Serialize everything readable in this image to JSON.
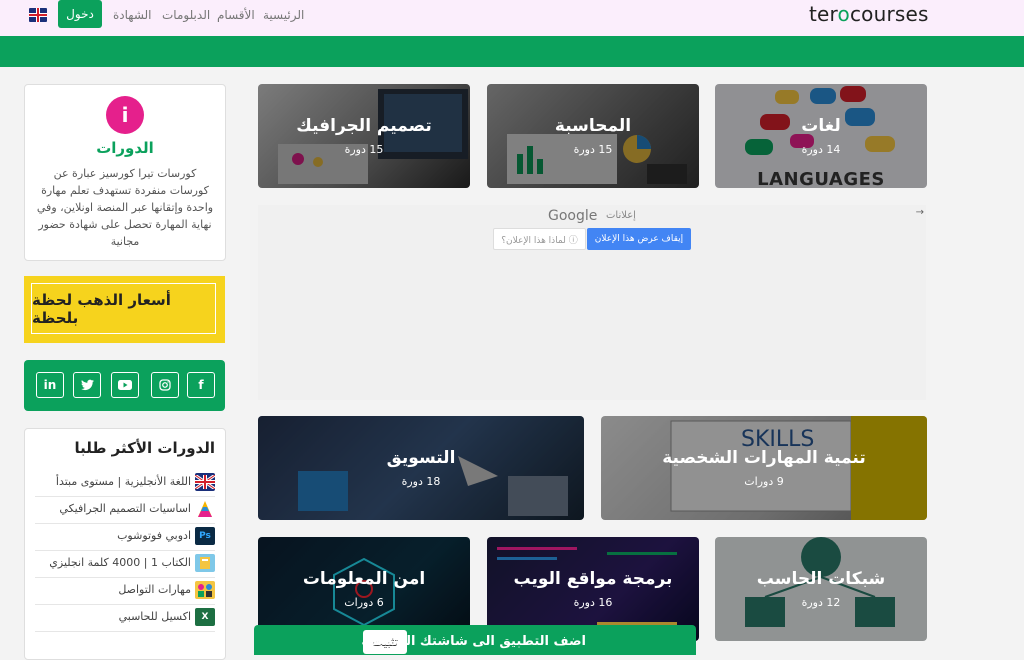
{
  "nav": {
    "logo_part1": "ter",
    "logo_o": "o",
    "logo_part2": "courses",
    "links": [
      "الرئيسية",
      "الأقسام",
      "الدبلومات",
      "الشهادة"
    ],
    "login_label": "دخول",
    "language_icon": "uk-flag-icon"
  },
  "sidebar": {
    "info_title": "الدورات",
    "info_icon": "info-icon",
    "info_text": "كورسات تيرا كورسيز عبارة عن كورسات منفردة تستهدف تعلم مهارة واحدة وإتقانها عبر المنصة اونلاين، وفي نهاية المهارة تحصل على شهادة حضور مجانية",
    "gold_banner": "أسعار الذهب لحظة بلحظة",
    "social": [
      "facebook-icon",
      "instagram-icon",
      "youtube-icon",
      "twitter-icon",
      "linkedin-icon"
    ],
    "popular_title": "الدورات الأكثر طلبا",
    "popular": [
      {
        "label": "اللغة الأنجليزية | مستوى مبتدأ",
        "icon": "uk-flag-icon"
      },
      {
        "label": "اساسيات التصميم الجرافيكي",
        "icon": "design-icon"
      },
      {
        "label": "ادوبي فوتوشوب",
        "icon": "photoshop-icon"
      },
      {
        "label": "الكتاب 1 | 4000 كلمة انجليزي",
        "icon": "book-icon"
      },
      {
        "label": "مهارات التواصل",
        "icon": "communication-icon"
      },
      {
        "label": "اكسيل للحاسبي",
        "icon": "excel-icon"
      }
    ]
  },
  "courses": [
    {
      "title": "لغات",
      "count": "14 دورة",
      "caption": "LANGUAGES"
    },
    {
      "title": "المحاسبة",
      "count": "15 دورة"
    },
    {
      "title": "تصميم الجرافيك",
      "count": "15 دورة"
    },
    {
      "title": "تنمية المهارات الشخصية",
      "count": "9 دورات"
    },
    {
      "title": "التسويق",
      "count": "18 دورة"
    },
    {
      "title": "شبكات الحاسب",
      "count": "12 دورة"
    },
    {
      "title": "برمجة مواقع الويب",
      "count": "16 دورة"
    },
    {
      "title": "امن المعلومات",
      "count": "6 دورات"
    }
  ],
  "ad": {
    "google": "Google",
    "label": "إعلانات",
    "stop_btn": "إيقاف عرض هذا الإعلان",
    "why_btn": "لماذا هذا الإعلان؟ ⓘ",
    "arrow": "→"
  },
  "install": {
    "text": "اضف التطبيق الى شاشتك الرئيسية",
    "button": "تثبيت"
  },
  "colors": {
    "brand_green": "#0ba15c",
    "accent_pink": "#e5208c",
    "gold": "#f6d31d"
  }
}
